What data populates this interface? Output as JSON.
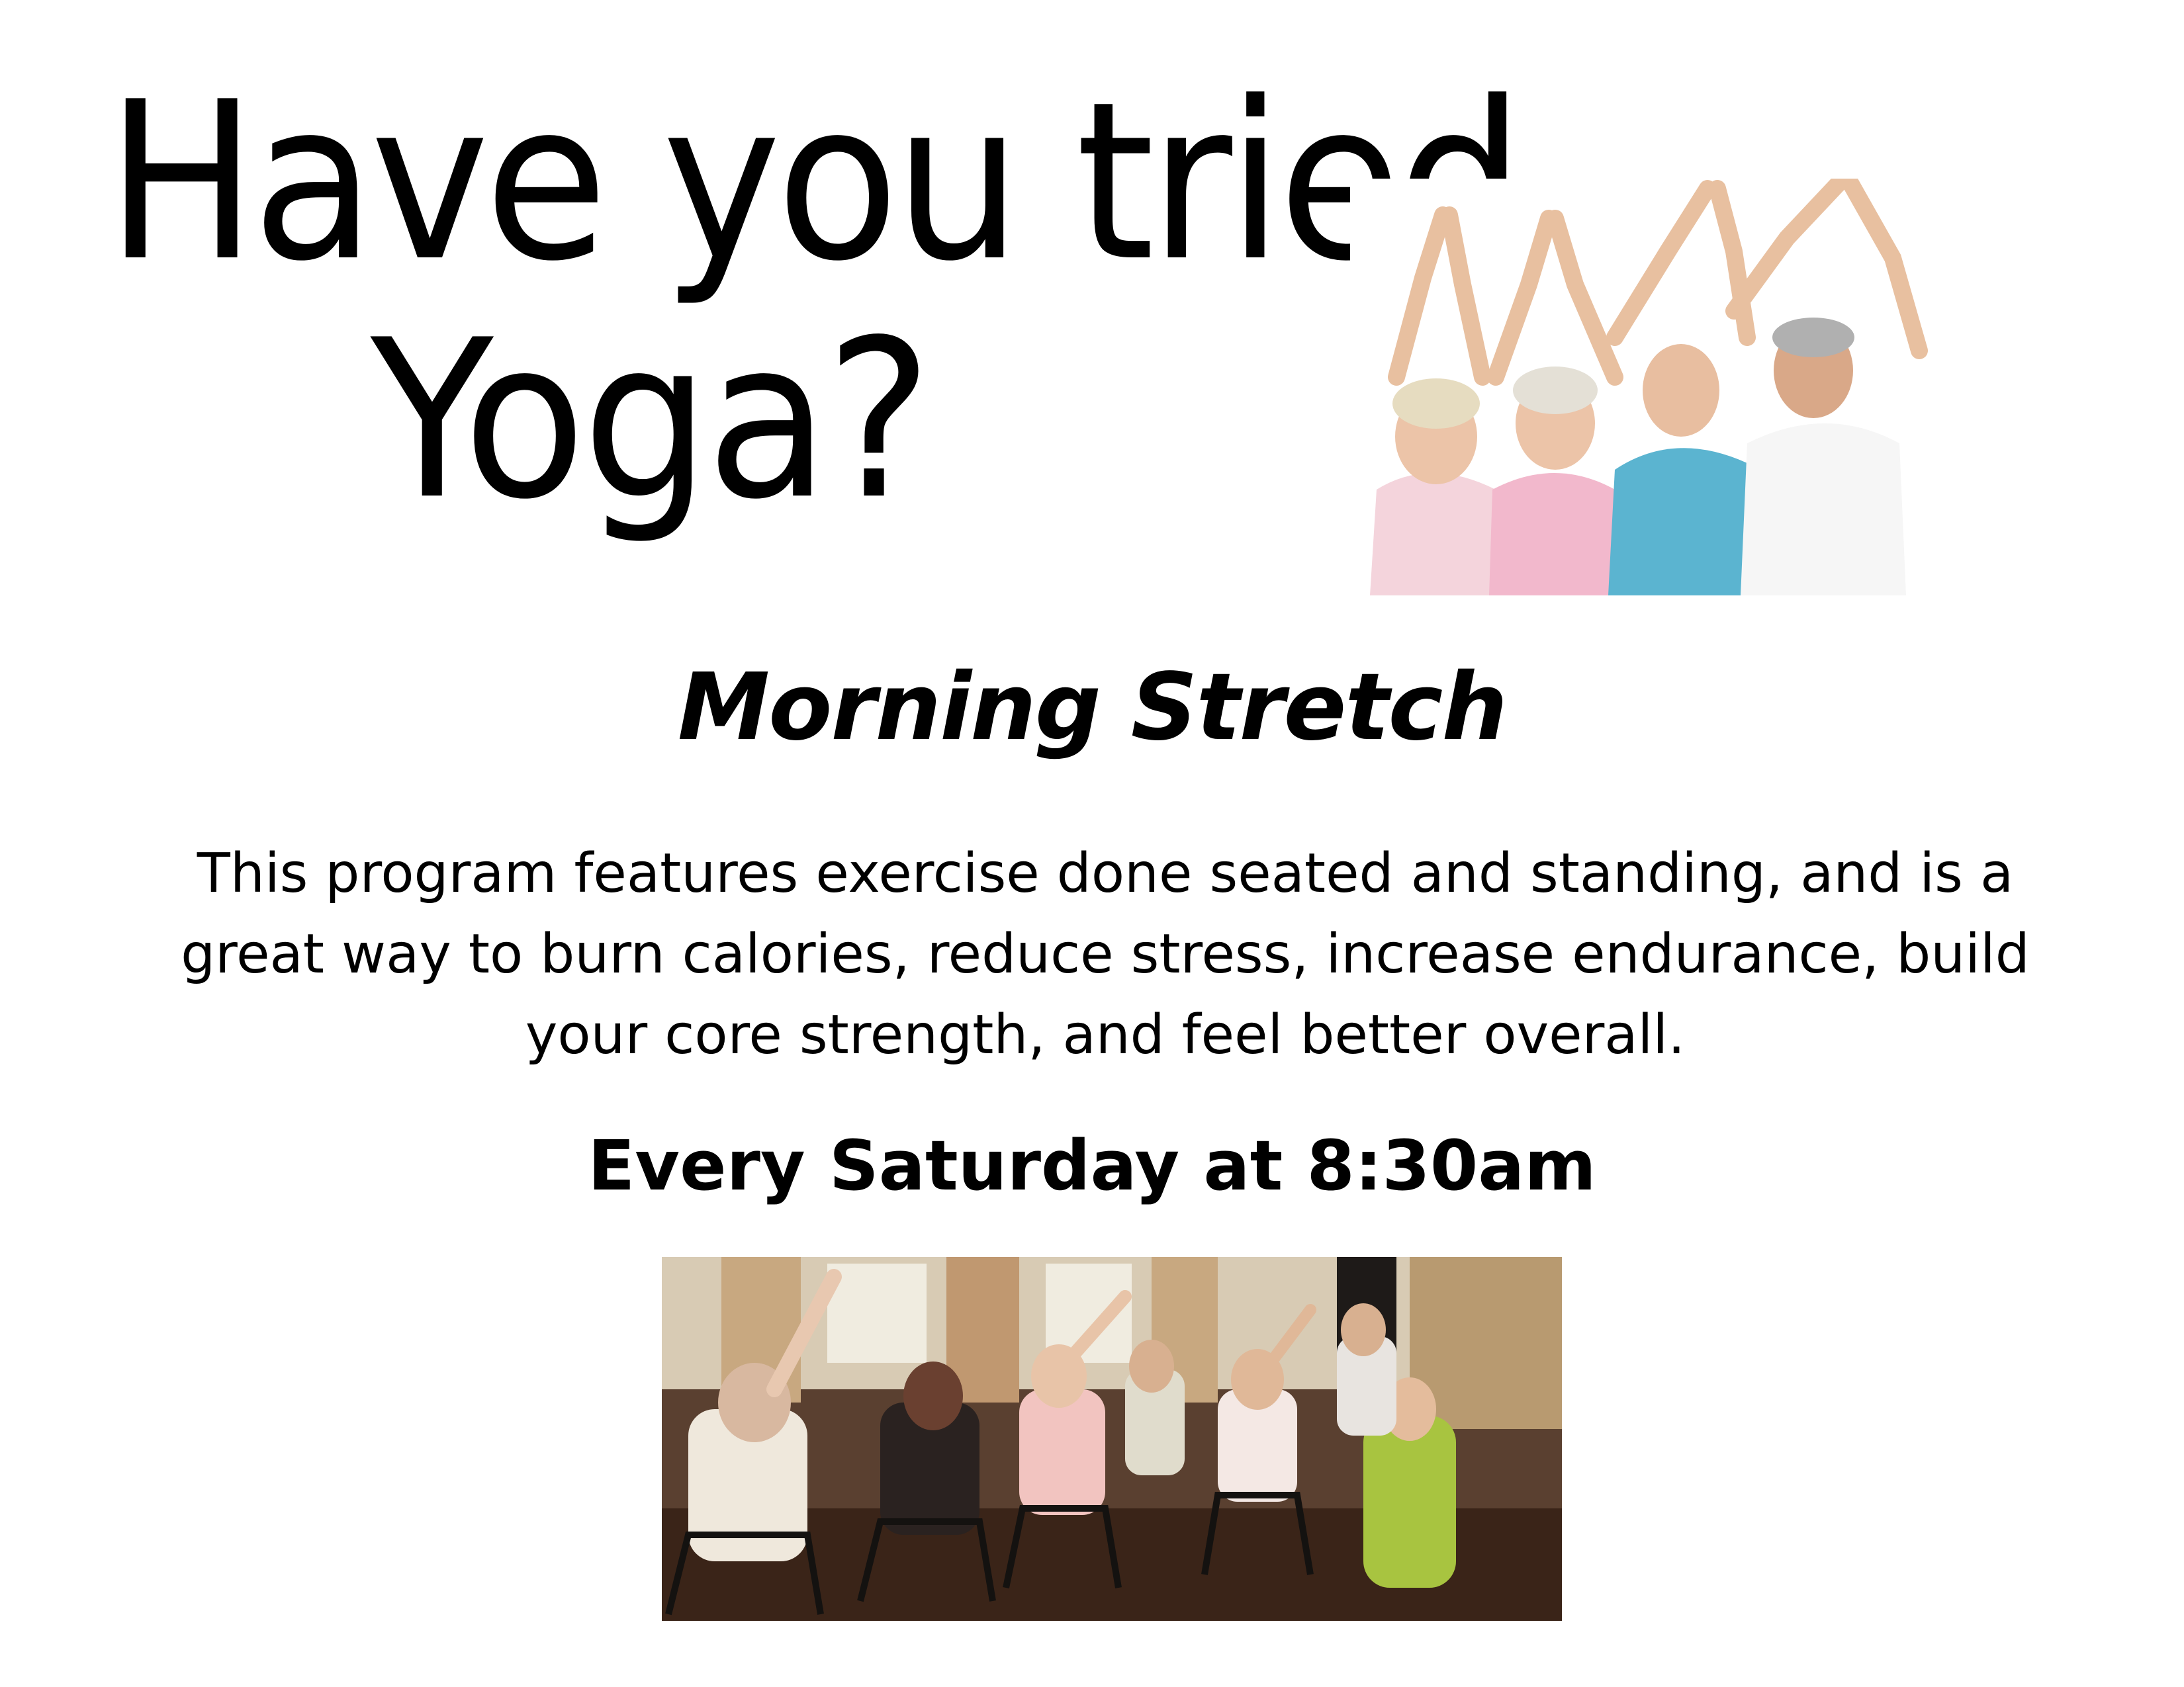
{
  "headline": {
    "line1": "Have you tried",
    "line2": "Yoga?"
  },
  "program": {
    "title": "Morning Stretch",
    "description": "This program features exercise done seated and standing, and is a great way to burn calories, reduce stress, increase endurance, build your core strength, and feel better overall.",
    "schedule": "Every Saturday at 8:30am"
  }
}
